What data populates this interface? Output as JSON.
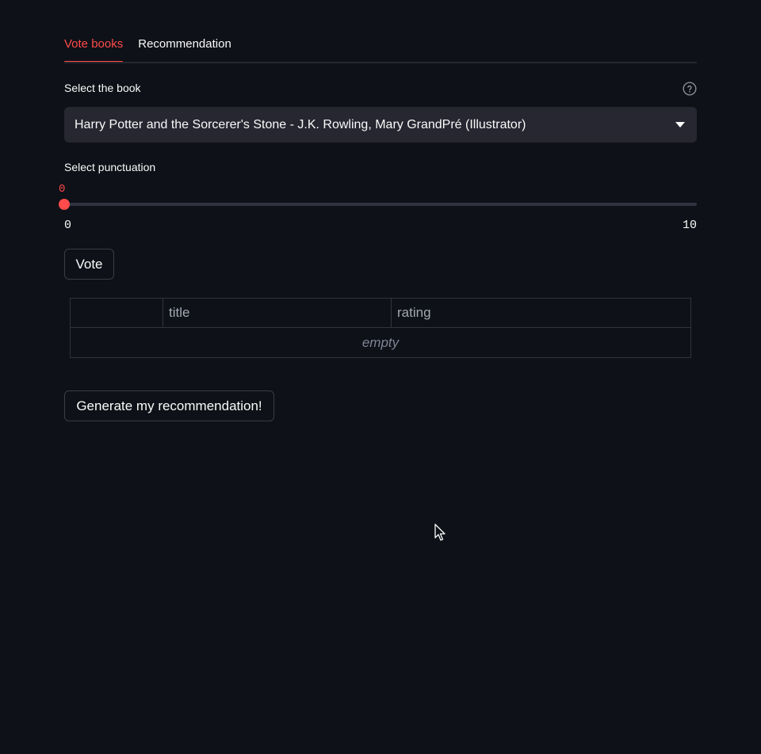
{
  "tabs": [
    {
      "label": "Vote books",
      "active": true
    },
    {
      "label": "Recommendation",
      "active": false
    }
  ],
  "book_select": {
    "label": "Select the book",
    "value": "Harry Potter and the Sorcerer's Stone - J.K. Rowling, Mary GrandPré (Illustrator)",
    "help_icon": "question-circle-icon",
    "caret_icon": "caret-down-icon"
  },
  "punctuation_slider": {
    "label": "Select punctuation",
    "value": "0",
    "min": "0",
    "max": "10"
  },
  "vote_button": {
    "label": "Vote"
  },
  "table": {
    "columns": [
      "",
      "title",
      "rating"
    ],
    "empty_text": "empty"
  },
  "generate_button": {
    "label": "Generate my recommendation!"
  },
  "colors": {
    "background": "#0e1117",
    "accent": "#ff4b4b",
    "text": "#fafafa",
    "input_bg": "#262730"
  }
}
